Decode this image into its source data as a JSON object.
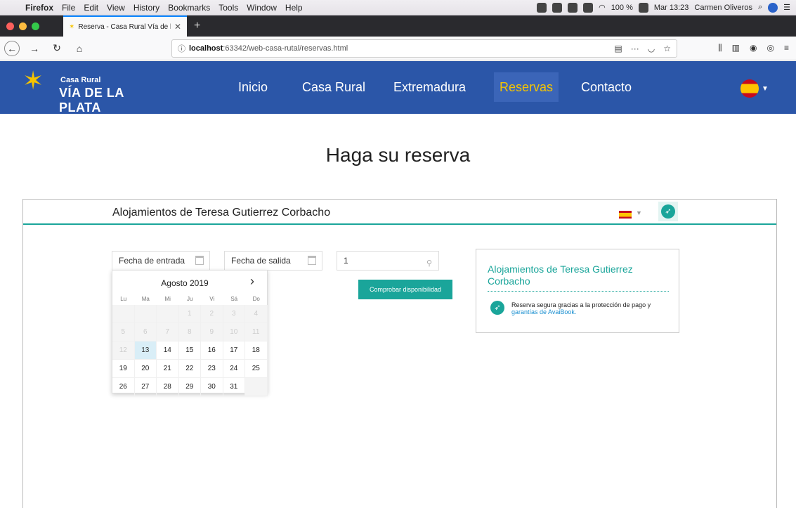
{
  "os_menubar": {
    "app": "Firefox",
    "items": [
      "File",
      "Edit",
      "View",
      "History",
      "Bookmarks",
      "Tools",
      "Window",
      "Help"
    ],
    "battery": "100 %",
    "clock": "Mar 13:23",
    "user": "Carmen Oliveros"
  },
  "browser": {
    "tab_title": "Reserva - Casa Rural Vía de la",
    "url_host": "localhost",
    "url_rest": ":63342/web-casa-rutal/reservas.html"
  },
  "site": {
    "logo_line1": "Casa Rural",
    "logo_line2": "VÍA DE LA PLATA",
    "nav": [
      "Inicio",
      "Casa Rural",
      "Extremadura",
      "Reservas",
      "Contacto"
    ],
    "active_nav": "Reservas"
  },
  "page": {
    "title": "Haga su reserva"
  },
  "widget": {
    "title": "Alojamientos de Teresa Gutierrez Corbacho",
    "checkin_placeholder": "Fecha de entrada",
    "checkout_placeholder": "Fecha de salida",
    "guests": "1",
    "check_button": "Comprobar disponibilidad",
    "calendar": {
      "month": "Agosto 2019",
      "weekdays": [
        "Lu",
        "Ma",
        "Mi",
        "Ju",
        "Vi",
        "Sá",
        "Do"
      ],
      "days": [
        [
          "",
          "",
          "",
          "1",
          "2",
          "3",
          "4"
        ],
        [
          "5",
          "6",
          "7",
          "8",
          "9",
          "10",
          "11"
        ],
        [
          "12",
          "13",
          "14",
          "15",
          "16",
          "17",
          "18"
        ],
        [
          "19",
          "20",
          "21",
          "22",
          "23",
          "24",
          "25"
        ],
        [
          "26",
          "27",
          "28",
          "29",
          "30",
          "31",
          ""
        ]
      ],
      "today": "13"
    },
    "info": {
      "title": "Alojamientos de Teresa Gutierrez Corbacho",
      "text": "Reserva segura gracias a la protección de pago y",
      "link": "garantías de AvaiBook."
    }
  },
  "colors": {
    "header_blue": "#2b56a8",
    "accent_yellow": "#f5c400",
    "teal": "#1aa59a"
  }
}
